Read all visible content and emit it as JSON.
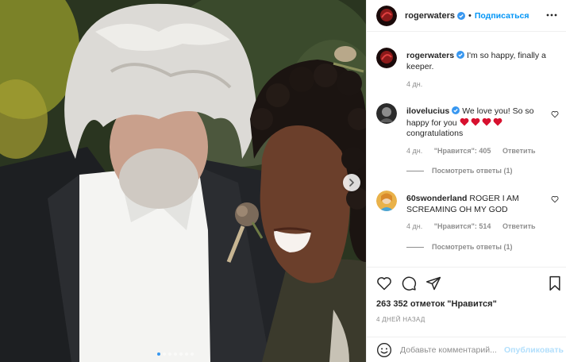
{
  "post": {
    "photo_alt": "",
    "carousel_dots": 7,
    "carousel_active_index": 0
  },
  "header": {
    "username": "rogerwaters",
    "separator": "•",
    "follow_label": "Подписаться"
  },
  "caption": {
    "username": "rogerwaters",
    "text": "I'm so happy, finally a keeper.",
    "time": "4 дн."
  },
  "comments": [
    {
      "username": "ilovelucius",
      "text_before": "We love you! So so happy for you",
      "hearts": 4,
      "text_after": "congratulations",
      "time": "4 дн.",
      "likes": "\"Нравится\": 405",
      "reply_label": "Ответить",
      "view_replies": "Посмотреть ответы (1)"
    },
    {
      "username": "60swonderland",
      "text": "ROGER I AM SCREAMING OH MY GOD",
      "time": "4 дн.",
      "likes": "\"Нравится\": 514",
      "reply_label": "Ответить",
      "view_replies": "Посмотреть ответы (1)"
    }
  ],
  "likes_line": "263 352 отметок \"Нравится\"",
  "time_ago": "4 ДНЕЙ НАЗАД",
  "comment_box": {
    "placeholder": "Добавьте комментарий...",
    "publish_label": "Опубликовать"
  },
  "colors": {
    "accent": "#0095f6",
    "verified": "#3897f0",
    "publish_disabled": "#b2dffc",
    "heart_emoji": "#d7102e",
    "muted": "#8e8e8e"
  }
}
